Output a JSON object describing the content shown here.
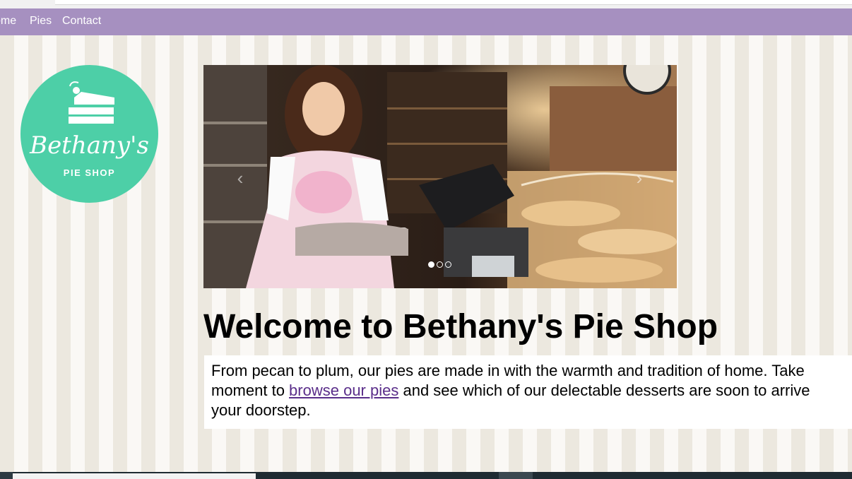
{
  "nav": {
    "items": [
      {
        "label": "ome"
      },
      {
        "label": "Pies"
      },
      {
        "label": "Contact"
      }
    ]
  },
  "logo": {
    "name": "Bethany's",
    "subtitle": "PIE SHOP",
    "icon": "pie-slice-icon"
  },
  "carousel": {
    "image": "baker-woman-holding-tray-of-pastries",
    "prev_arrow": "‹",
    "next_arrow": "›",
    "slide_count": 3,
    "active_slide": 1
  },
  "main": {
    "heading": "Welcome to Bethany's Pie Shop",
    "intro": {
      "line1": "From pecan to plum, our pies are made in with the warmth and tradition of home. Take",
      "line2_before": "moment to ",
      "link": "browse our pies",
      "line2_after": " and see which of our delectable desserts are soon to arrive",
      "line3": "your doorstep."
    }
  },
  "colors": {
    "navbar": "#a690c0",
    "logo_circle": "#4dcfa7",
    "stripe_dark": "#ece8df",
    "stripe_light": "#faf8f5",
    "link": "#5a2e8a"
  }
}
